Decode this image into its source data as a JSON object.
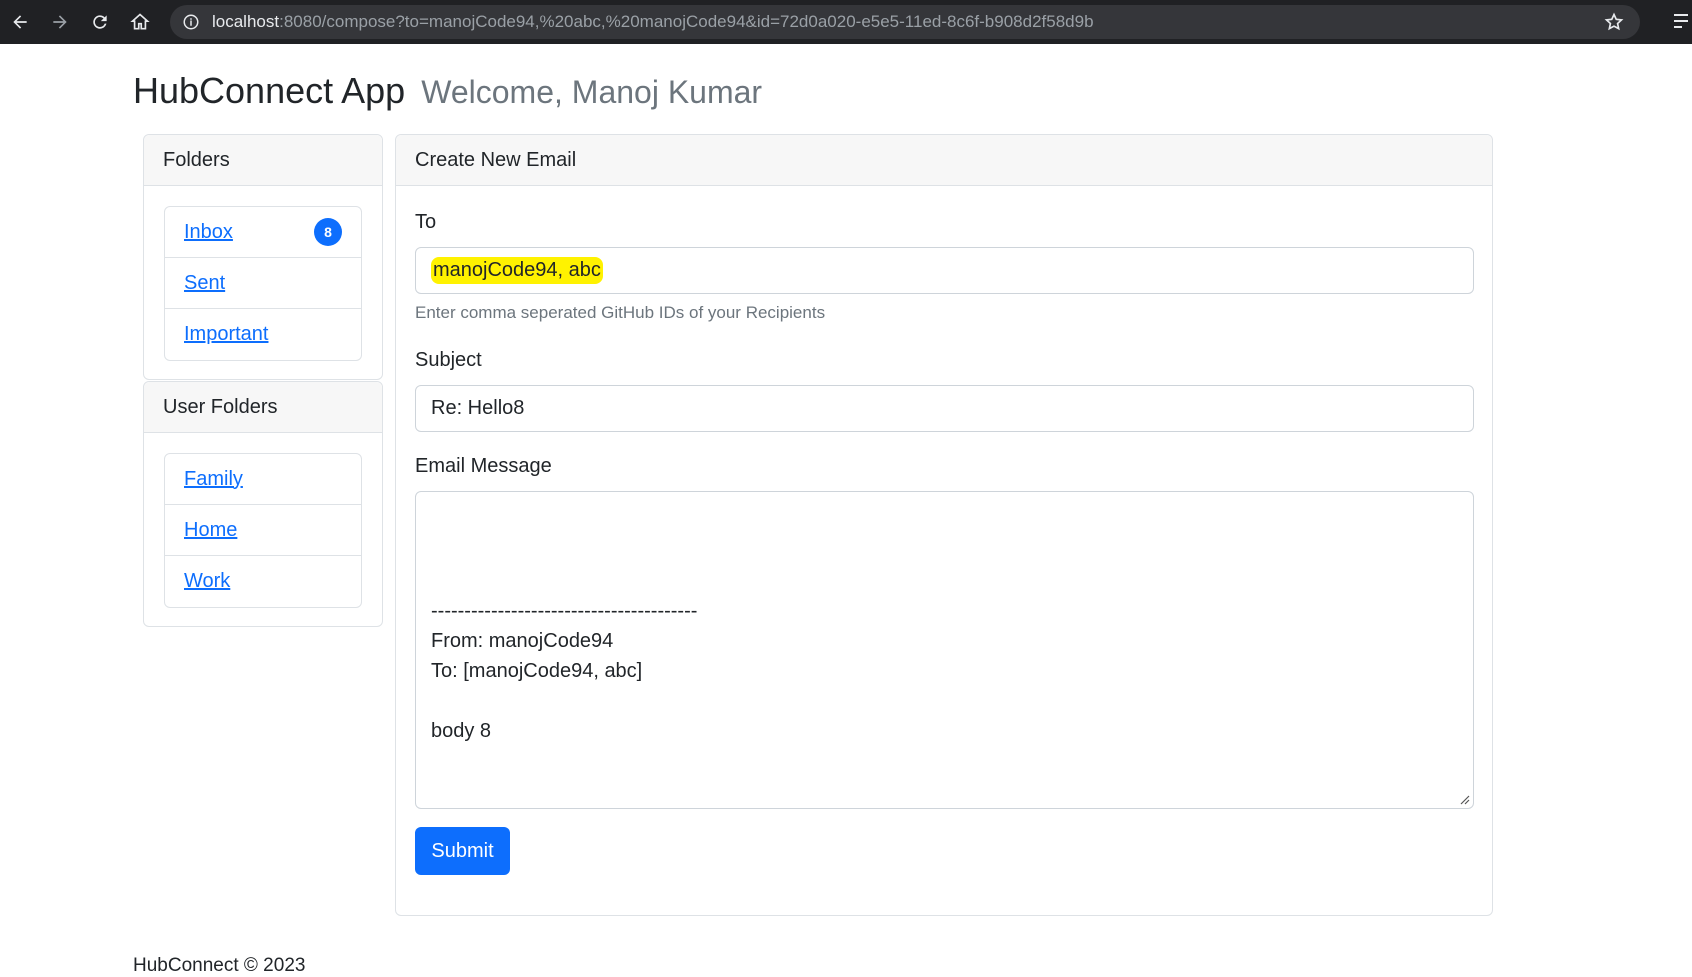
{
  "browser": {
    "url_host": "localhost",
    "url_rest": ":8080/compose?to=manojCode94,%20abc,%20manojCode94&id=72d0a020-e5e5-11ed-8c6f-b908d2f58d9b"
  },
  "header": {
    "app_name": "HubConnect App",
    "welcome": "Welcome, Manoj Kumar"
  },
  "folders": {
    "title": "Folders",
    "items": [
      {
        "label": "Inbox",
        "badge": "8"
      },
      {
        "label": "Sent"
      },
      {
        "label": "Important"
      }
    ]
  },
  "user_folders": {
    "title": "User Folders",
    "items": [
      {
        "label": "Family"
      },
      {
        "label": "Home"
      },
      {
        "label": "Work"
      }
    ]
  },
  "compose": {
    "title": "Create New Email",
    "to_label": "To",
    "to_value": "manojCode94, abc",
    "to_help": "Enter comma seperated GitHub IDs of your Recipients",
    "subject_label": "Subject",
    "subject_value": "Re: Hello8",
    "message_label": "Email Message",
    "message_value": "\n\n----------------------------------------\nFrom: manojCode94\nTo: [manojCode94, abc]\n\nbody 8",
    "submit_label": "Submit"
  },
  "footer": {
    "text": "HubConnect © 2023"
  },
  "colors": {
    "primary": "#0d6efd",
    "highlight": "#fff200",
    "chrome": "#202124"
  }
}
